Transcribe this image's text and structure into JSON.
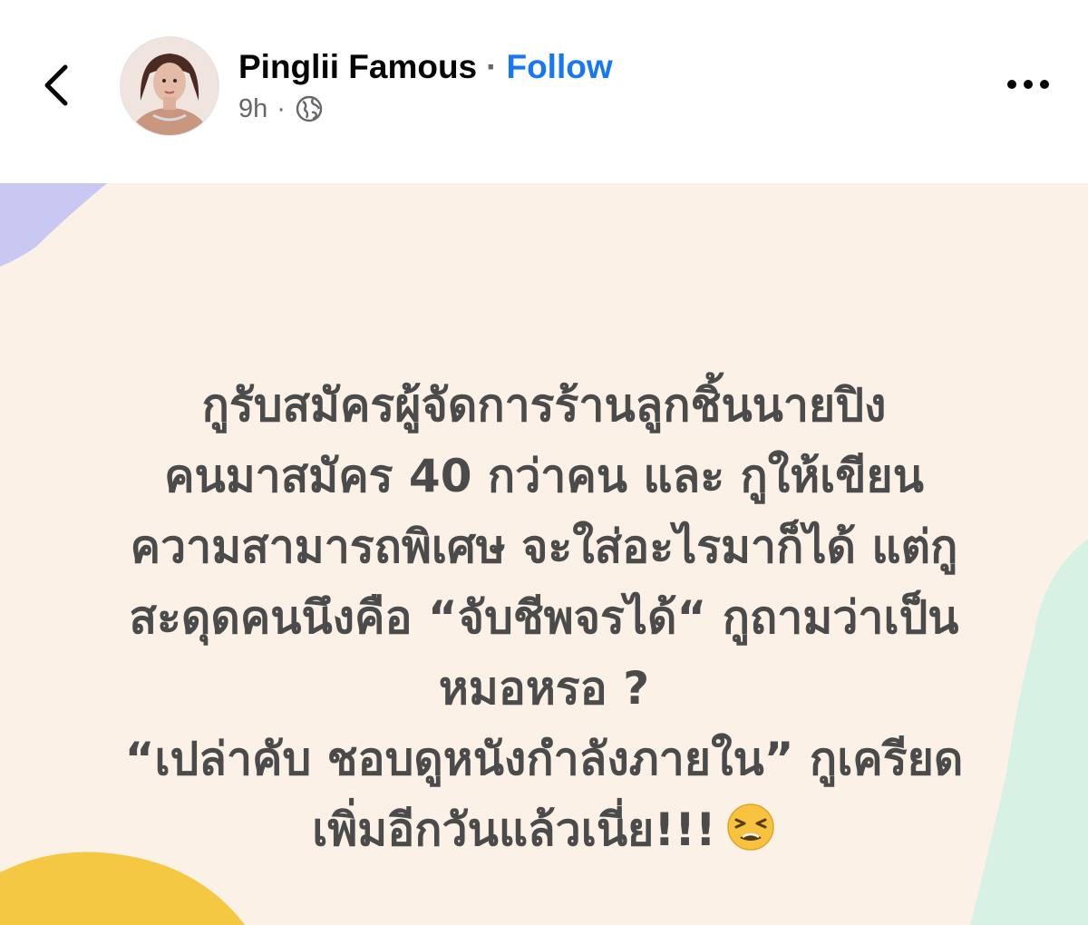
{
  "header": {
    "author_name": "Pinglii Famous",
    "separator": "·",
    "follow_label": "Follow",
    "time": "9h",
    "meta_separator": "·",
    "icons": {
      "back": "chevron-left-icon",
      "privacy": "globe-icon",
      "more": "more-horizontal-icon"
    }
  },
  "post": {
    "text": "กูรับสมัครผู้จัดการร้านลูกชิ้นนายปิง\nคนมาสมัคร 40 กว่าคน และ  กูให้เขียน\nความสามารถพิเศษ จะใส่อะไรมาก็ได้ แต่กู\nสะดุดคนนึงคือ “จับชีพจรได้“ กูถามว่าเป็น\nหมอหรอ ?\n“เปล่าคับ ชอบดูหนังกำลังภายใน” กูเครียด\nเพิ่มอีกวันแล้วเนี่ย!!!",
    "emoji": "tired-face-emoji",
    "colors": {
      "background": "#fcf1e7",
      "text": "#4b4b4b",
      "blob_purple": "#c9c8f2",
      "blob_mint": "#d7f1e4",
      "blob_yellow": "#f4c842"
    }
  },
  "colors": {
    "accent": "#1877f2",
    "name": "#050505",
    "secondary": "#65676b"
  }
}
